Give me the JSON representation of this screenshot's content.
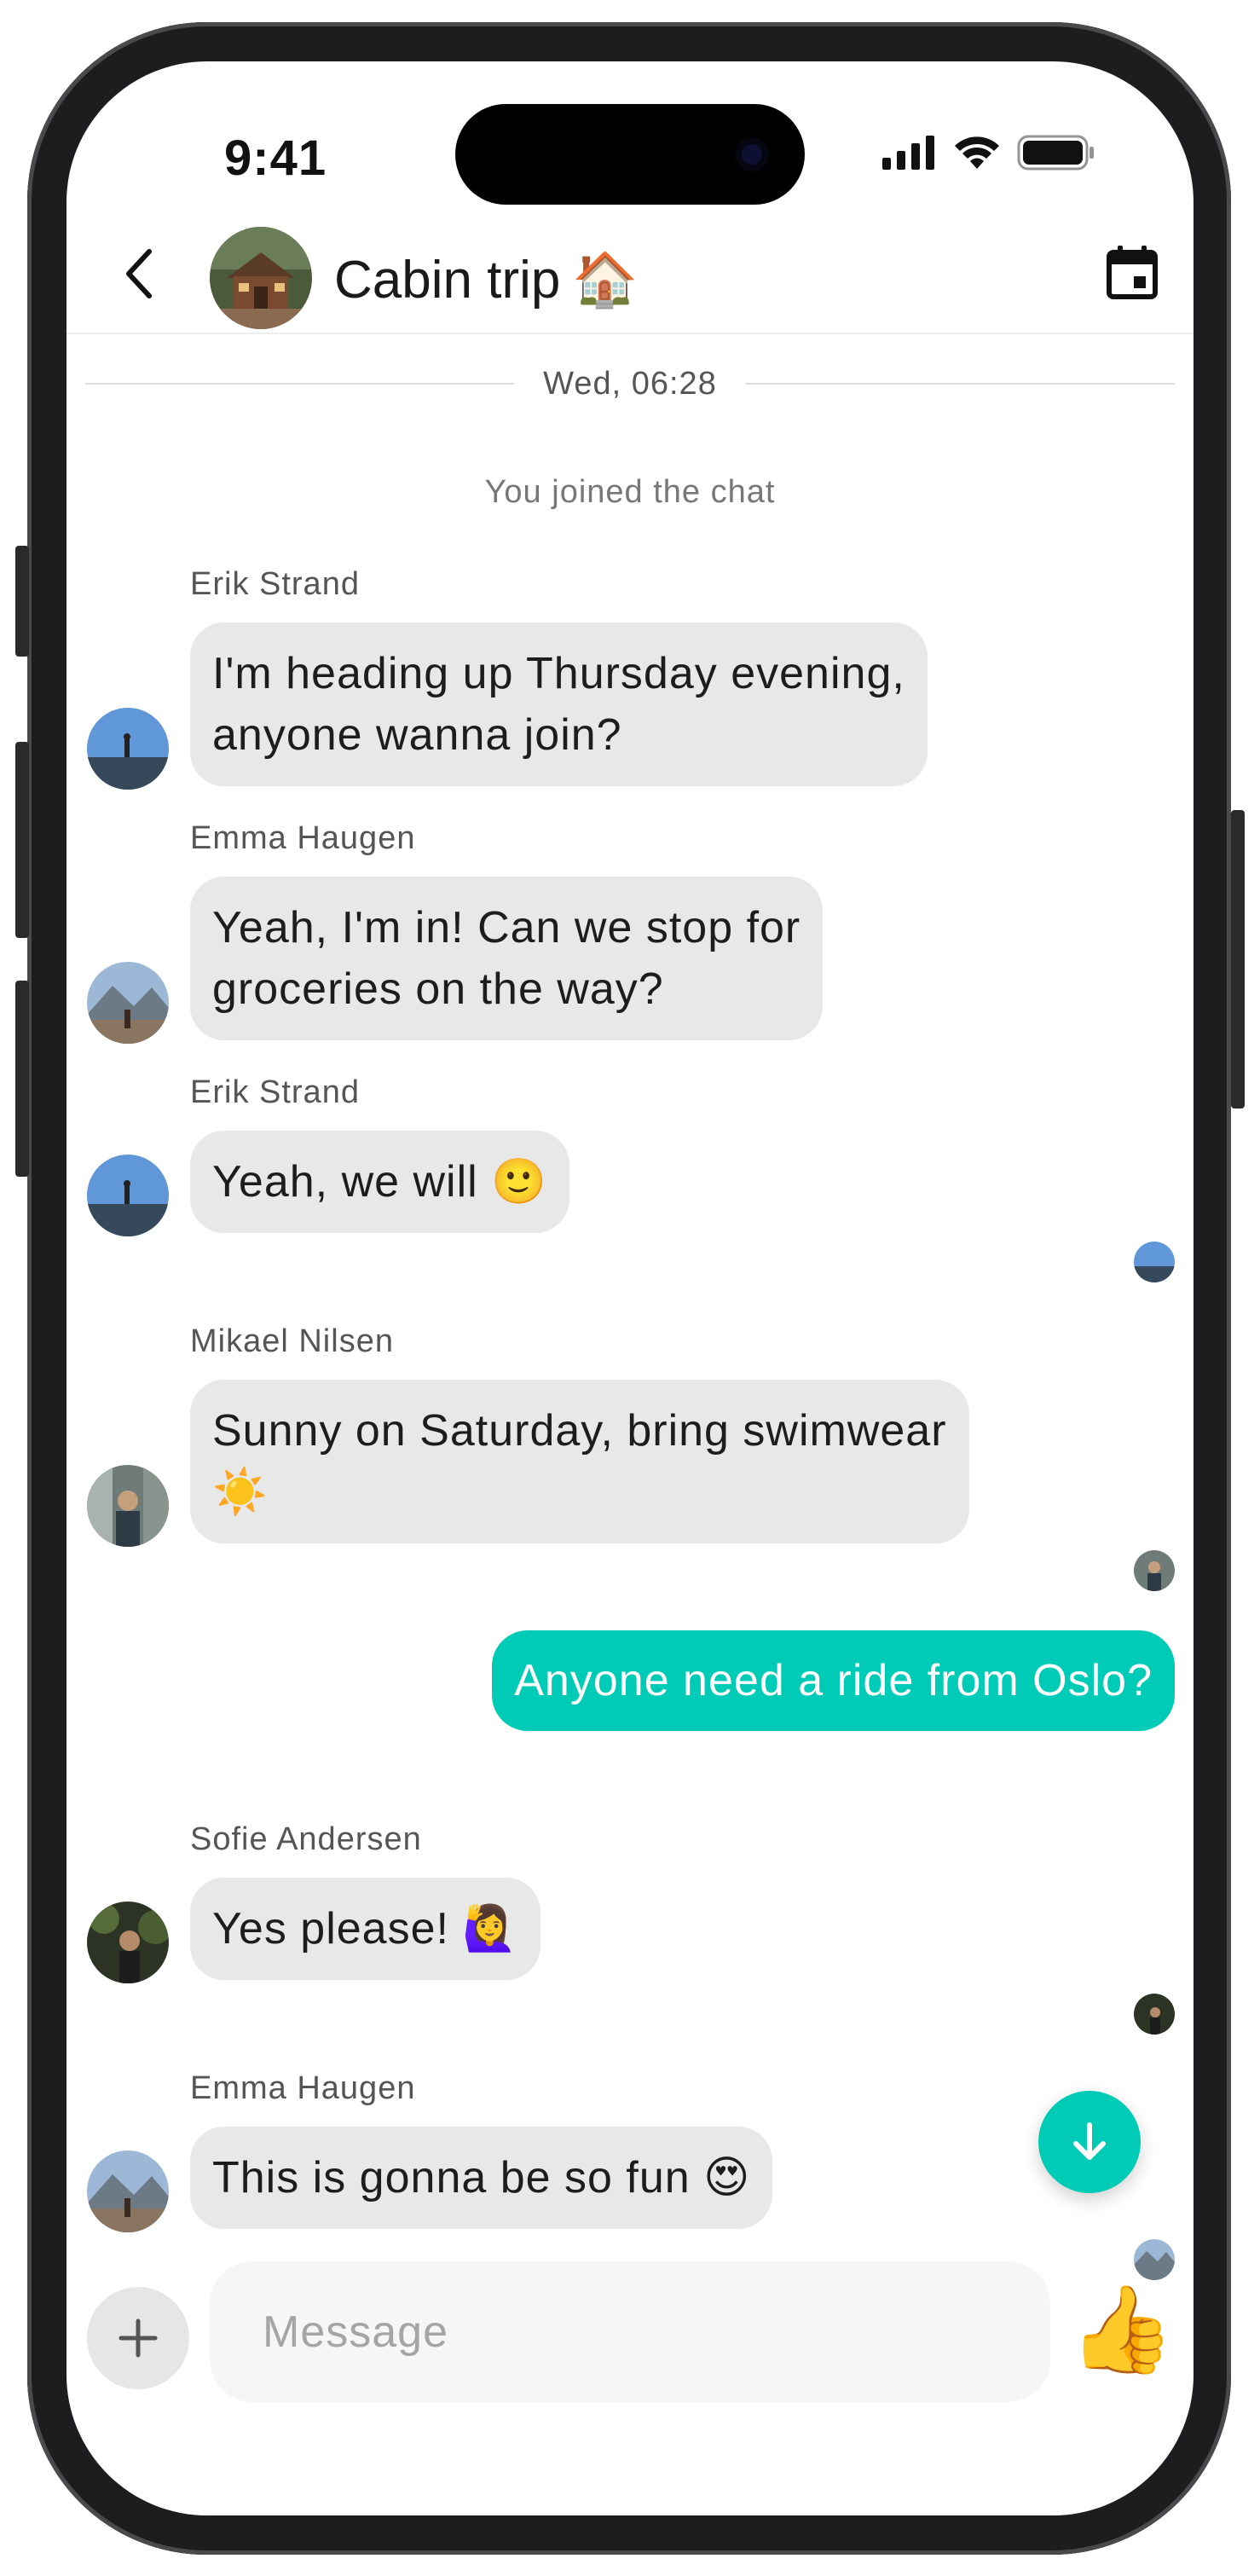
{
  "status_bar": {
    "time": "9:41"
  },
  "header": {
    "title": "Cabin trip",
    "title_emoji": "🏠",
    "back_icon": "chevron-left-icon",
    "calendar_icon": "calendar-icon"
  },
  "date_separator": "Wed, 06:28",
  "system_message": "You joined the chat",
  "messages": [
    {
      "sender": "Erik Strand",
      "lines": [
        "I'm heading up Thursday evening,",
        "anyone wanna join?"
      ]
    },
    {
      "sender": "Emma Haugen",
      "lines": [
        "Yeah, I'm in! Can we stop for",
        "groceries on the way?"
      ]
    },
    {
      "sender": "Erik Strand",
      "lines": [
        "Yeah, we will 🙂"
      ]
    },
    {
      "sender": "Mikael Nilsen",
      "lines": [
        "Sunny on Saturday, bring swimwear",
        "☀️"
      ]
    },
    {
      "sender": "",
      "outgoing": true,
      "lines": [
        "Anyone need a ride from Oslo?"
      ]
    },
    {
      "sender": "Sofie Andersen",
      "lines": [
        "Yes please! 🙋‍♀️"
      ]
    },
    {
      "sender": "Emma Haugen",
      "lines": [
        "This is gonna be so fun 😍"
      ]
    }
  ],
  "composer": {
    "placeholder": "Message",
    "like_emoji": "👍"
  },
  "colors": {
    "accent": "#00cbb6",
    "bubble_incoming": "#e8e8e8",
    "composer_bg": "#f6f6f6"
  }
}
